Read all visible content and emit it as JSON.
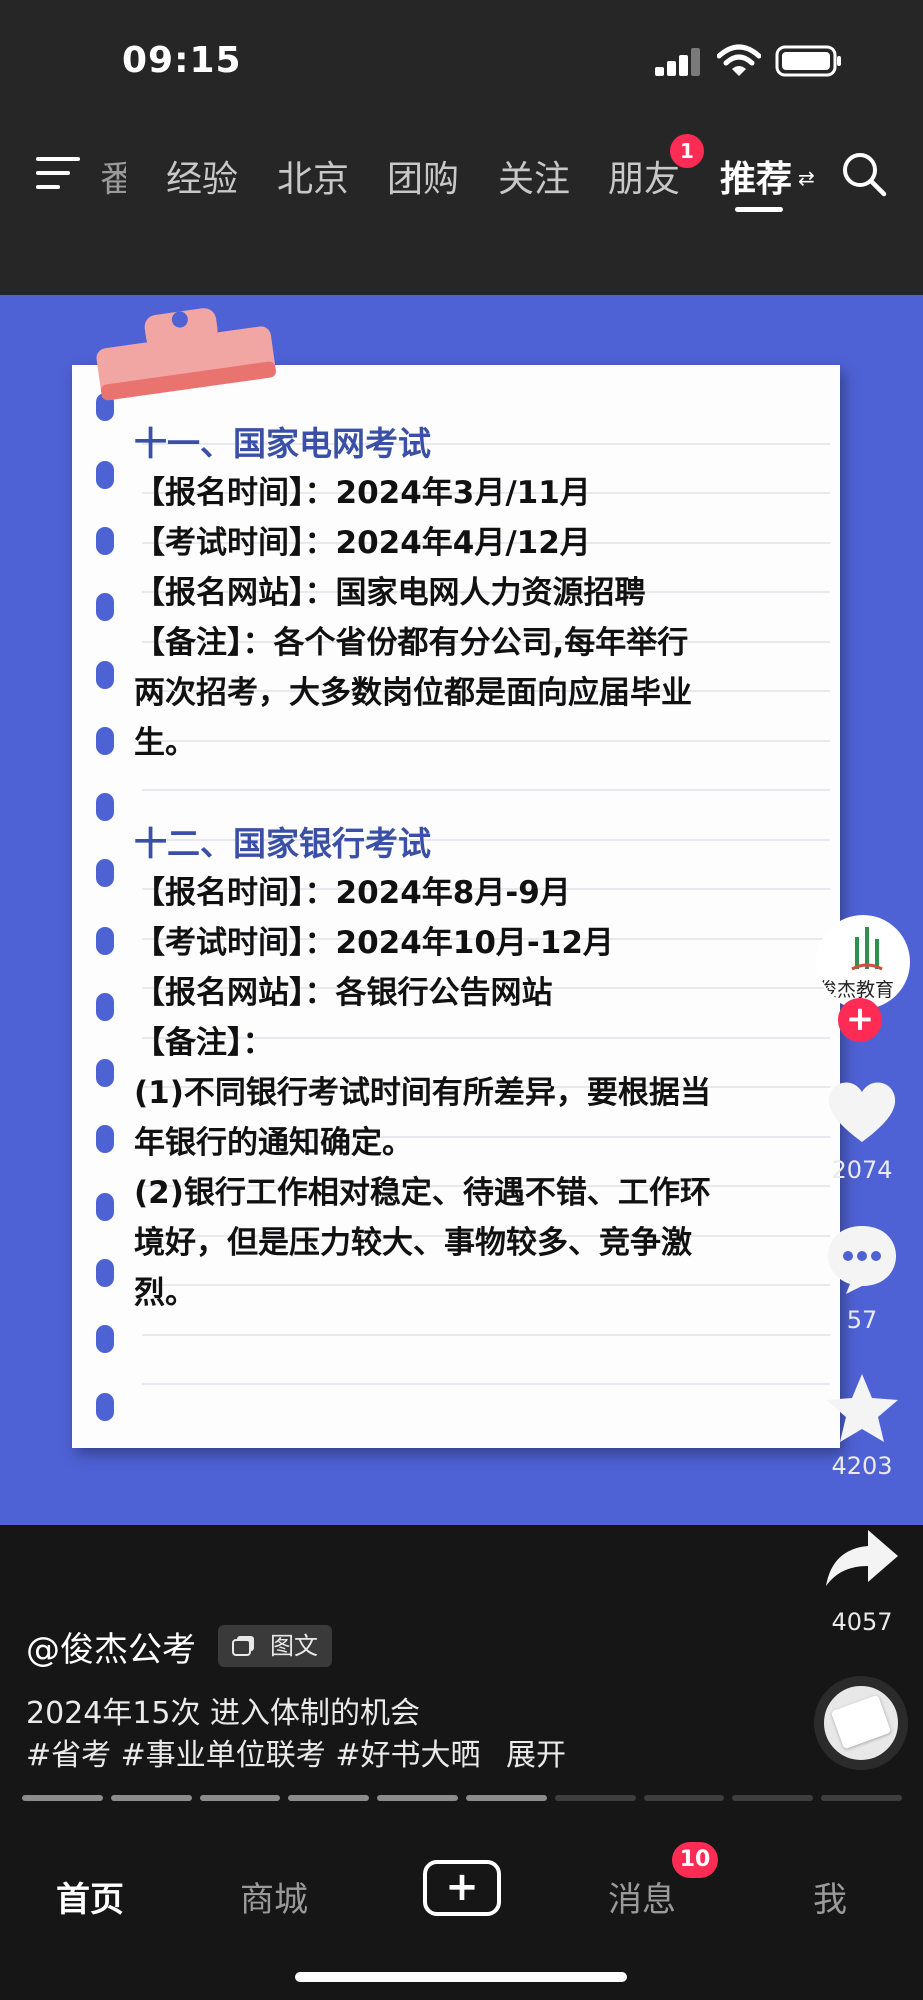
{
  "status_bar": {
    "time": "09:15"
  },
  "top_nav": {
    "partial_tab": "番",
    "tabs": [
      "经验",
      "北京",
      "团购",
      "关注",
      "朋友"
    ],
    "active_tab": "推荐",
    "friends_badge": "1",
    "switch_icon_glyph": "⇄"
  },
  "post": {
    "section_11": {
      "title": "十一、国家电网考试",
      "lines": [
        "【报名时间】：2024年3月/11月",
        "【考试时间】：2024年4月/12月",
        "【报名网站】：国家电网人力资源招聘",
        "【备注】：各个省份都有分公司,每年举行",
        "两次招考，大多数岗位都是面向应届毕业",
        "生。"
      ]
    },
    "section_12": {
      "title": "十二、国家银行考试",
      "lines": [
        "【报名时间】：2024年8月-9月",
        "【考试时间】：2024年10月-12月",
        "【报名网站】：各银行公告网站",
        "【备注】：",
        "(1)不同银行考试时间有所差异，要根据当",
        "年银行的通知确定。",
        "(2)银行工作相对稳定、待遇不错、工作环",
        "境好，但是压力较大、事物较多、竞争激",
        "烈。"
      ]
    }
  },
  "right_rail": {
    "avatar_text": "俊杰教育",
    "likes": "2074",
    "comments": "57",
    "favorites": "4203",
    "shares": "4057"
  },
  "info": {
    "author": "@俊杰公考",
    "type_badge": "图文",
    "caption": "2024年15次 进入体制的机会",
    "tags": "#省考 #事业单位联考 #好书大晒",
    "expand": "展开"
  },
  "progress": {
    "segments_total": 10,
    "segments_viewed": 6
  },
  "bottom_tabs": {
    "home": "首页",
    "mall": "商城",
    "add": "+",
    "messages": "消息",
    "messages_badge": "10",
    "me": "我"
  },
  "colors": {
    "background_blue": "#4f62d5",
    "section_title": "#3a4fa6",
    "accent_red": "#fe2c55"
  }
}
